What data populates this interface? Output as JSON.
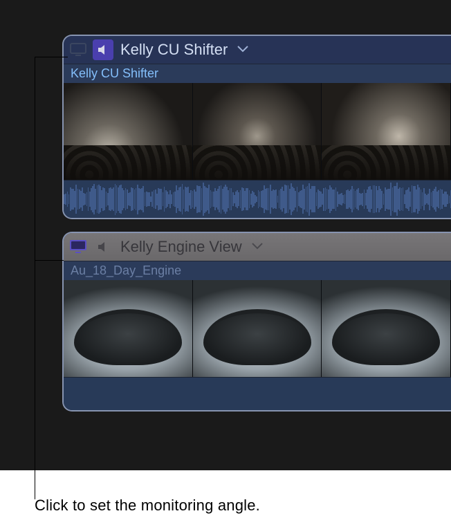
{
  "callout": "Click to set the monitoring angle.",
  "angles": [
    {
      "monitor_active": false,
      "audio_active": true,
      "title": "Kelly CU Shifter",
      "clip_name": "Kelly CU Shifter",
      "has_waveform": true
    },
    {
      "monitor_active": true,
      "audio_active": false,
      "title": "Kelly Engine View",
      "clip_name": "Au_18_Day_Engine",
      "has_waveform": false
    }
  ],
  "icons": {
    "monitor": "monitor-icon",
    "speaker": "speaker-icon",
    "chevron": "chevron-down-icon"
  }
}
